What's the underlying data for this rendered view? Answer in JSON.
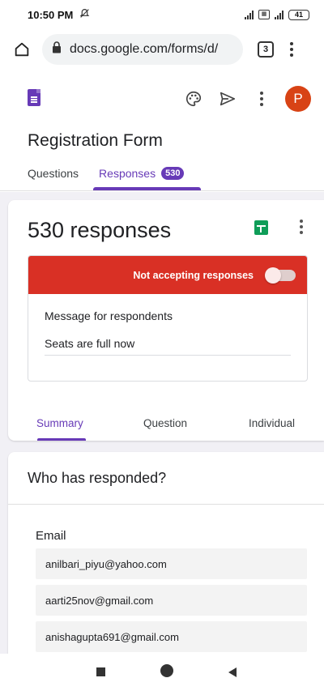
{
  "status_bar": {
    "time": "10:50 PM",
    "battery": "41"
  },
  "browser": {
    "url": "docs.google.com/forms/d/",
    "tab_count": "3"
  },
  "form": {
    "title": "Registration Form",
    "avatar_letter": "P",
    "tabs": {
      "questions": "Questions",
      "responses": "Responses",
      "responses_badge": "530"
    }
  },
  "summary_card": {
    "count_text": "530 responses",
    "accepting_label": "Not accepting responses",
    "accepting": false,
    "message_label": "Message for respondents",
    "message_value": "Seats are full now",
    "subtabs": [
      "Summary",
      "Question",
      "Individual"
    ]
  },
  "responders": {
    "heading": "Who has responded?",
    "column": "Email",
    "emails": [
      "anilbari_piyu@yahoo.com",
      "aarti25nov@gmail.com",
      "anishagupta691@gmail.com"
    ]
  },
  "colors": {
    "accent": "#673ab7",
    "closed_banner": "#d93025",
    "avatar": "#d84315",
    "sheets": "#0f9d58"
  }
}
